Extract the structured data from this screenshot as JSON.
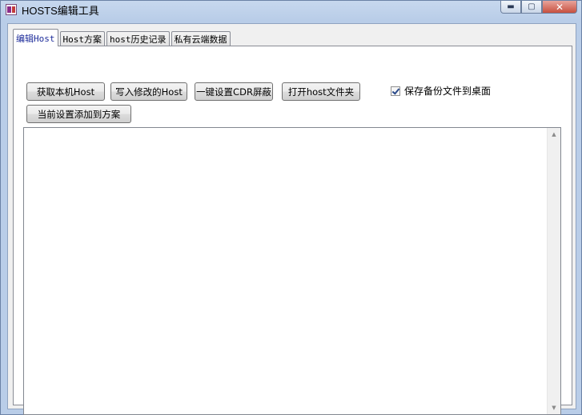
{
  "window": {
    "title": "HOSTS编辑工具",
    "min_glyph": "▬",
    "max_glyph": "▢",
    "close_glyph": "✕"
  },
  "tabs": [
    {
      "label": "编辑Host",
      "active": true
    },
    {
      "label": "Host方案",
      "active": false
    },
    {
      "label": "host历史记录",
      "active": false
    },
    {
      "label": "私有云端数据",
      "active": false
    }
  ],
  "toolbar": {
    "get_local_host": "获取本机Host",
    "write_modified_host": "写入修改的Host",
    "one_click_cdr_block": "一键设置CDR屏蔽",
    "open_host_folder": "打开host文件夹",
    "add_to_scheme": "当前设置添加到方案",
    "backup_checkbox_label": "保存备份文件到桌面",
    "backup_checked": true
  },
  "editor": {
    "content": "",
    "scroll_up_glyph": "▲",
    "scroll_down_glyph": "▼"
  },
  "icons": {
    "app": "app-icon",
    "minimize": "minimize-icon",
    "maximize": "maximize-icon",
    "close": "close-icon",
    "checkmark": "checkmark-icon"
  }
}
